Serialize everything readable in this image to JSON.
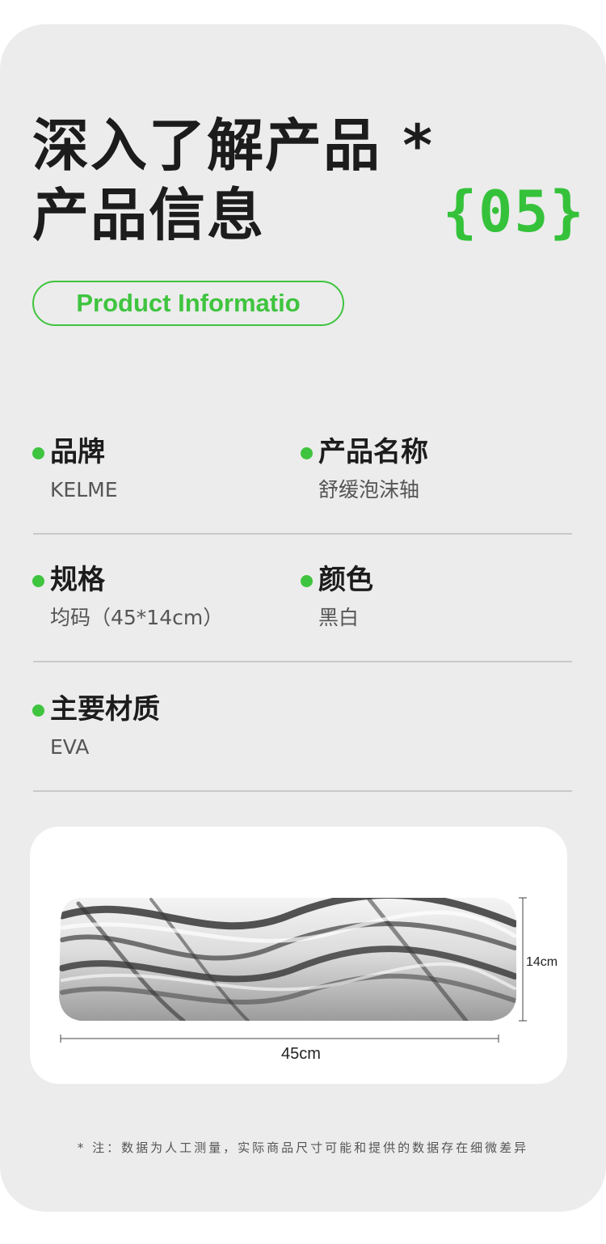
{
  "heading": {
    "line1": "深入了解产品 *",
    "line2": "产品信息",
    "number": "{05}"
  },
  "tag": "Product Informatio",
  "specs": [
    {
      "label": "品牌",
      "value": "KELME"
    },
    {
      "label": "产品名称",
      "value": "舒缓泡沫轴"
    },
    {
      "label": "规格",
      "value": "均码（45*14cm）"
    },
    {
      "label": "颜色",
      "value": "黑白"
    },
    {
      "label": "主要材质",
      "value": "EVA"
    }
  ],
  "image": {
    "height_label": "14cm",
    "width_label": "45cm"
  },
  "note": "* 注：数据为人工测量，实际商品尺寸可能和提供的数据存在细微差异",
  "colors": {
    "accent": "#3fc43f",
    "background": "#ececec",
    "title": "#1c1c1c"
  }
}
